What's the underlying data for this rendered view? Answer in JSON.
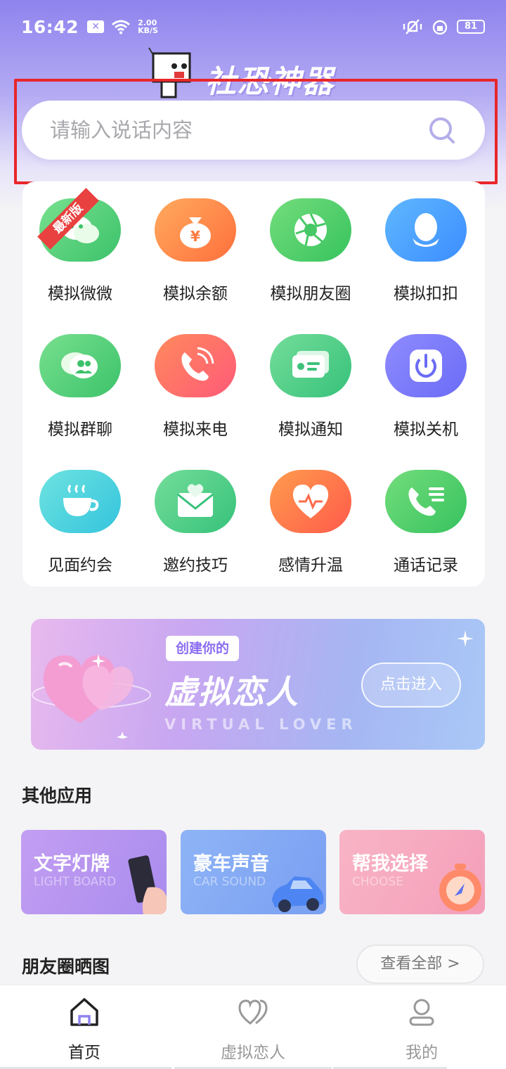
{
  "status_bar": {
    "time": "16:42",
    "net_speed_value": "2.00",
    "net_speed_unit": "KB/S",
    "battery": "81"
  },
  "header": {
    "app_title": "社恐神器"
  },
  "search": {
    "placeholder": "请输入说话内容"
  },
  "grid": {
    "ribbon": "最新版",
    "items": [
      {
        "label": "模拟微微",
        "icon": "wechat-icon"
      },
      {
        "label": "模拟余额",
        "icon": "money-bag-icon"
      },
      {
        "label": "模拟朋友圈",
        "icon": "aperture-icon"
      },
      {
        "label": "模拟扣扣",
        "icon": "penguin-icon"
      },
      {
        "label": "模拟群聊",
        "icon": "group-chat-icon"
      },
      {
        "label": "模拟来电",
        "icon": "phone-ringing-icon"
      },
      {
        "label": "模拟通知",
        "icon": "notification-icon"
      },
      {
        "label": "模拟关机",
        "icon": "power-icon"
      },
      {
        "label": "见面约会",
        "icon": "coffee-cup-icon"
      },
      {
        "label": "邀约技巧",
        "icon": "heart-envelope-icon"
      },
      {
        "label": "感情升温",
        "icon": "heartbeat-icon"
      },
      {
        "label": "通话记录",
        "icon": "call-log-icon"
      }
    ]
  },
  "banner": {
    "chip": "创建你的",
    "title": "虚拟恋人",
    "subtitle": "VIRTUAL LOVER",
    "button": "点击进入"
  },
  "other_apps": {
    "title": "其他应用",
    "items": [
      {
        "title": "文字灯牌",
        "subtitle": "LIGHT BOARD",
        "color": "#b99af0"
      },
      {
        "title": "豪车声音",
        "subtitle": "CAR SOUND",
        "color": "#8fb0f5"
      },
      {
        "title": "帮我选择",
        "subtitle": "CHOOSE",
        "color": "#f6a9c0"
      }
    ]
  },
  "moments": {
    "title": "朋友圈晒图",
    "view_all": "查看全部 >"
  },
  "bottom_nav": {
    "items": [
      {
        "label": "首页",
        "icon": "home-icon"
      },
      {
        "label": "虚拟恋人",
        "icon": "double-heart-icon"
      },
      {
        "label": "我的",
        "icon": "user-icon"
      }
    ]
  },
  "colors": {
    "accent": "#8f83ee",
    "highlight_frame": "#e8262a"
  }
}
